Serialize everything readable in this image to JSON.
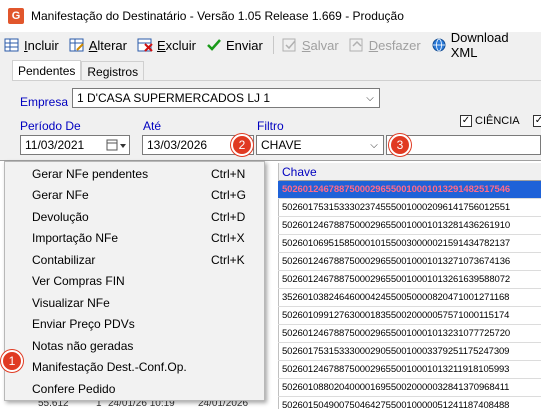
{
  "window": {
    "app_icon": "G",
    "title": "Manifestação do Destinatário - Versão 1.05 Release 1.669 - Produção"
  },
  "toolbar": [
    {
      "name": "incluir",
      "pre": "",
      "u": "I",
      "post": "ncluir",
      "icon": "grid-add-icon",
      "disabled": false
    },
    {
      "name": "alterar",
      "pre": "",
      "u": "A",
      "post": "lterar",
      "icon": "grid-edit-icon",
      "disabled": false
    },
    {
      "name": "excluir",
      "pre": "",
      "u": "E",
      "post": "xcluir",
      "icon": "grid-delete-icon",
      "disabled": false
    },
    {
      "name": "enviar",
      "pre": "",
      "u": "",
      "post": "Enviar",
      "icon": "checkmark-icon",
      "disabled": false
    },
    {
      "name": "salvar",
      "pre": "",
      "u": "S",
      "post": "alvar",
      "icon": "save-icon",
      "disabled": true
    },
    {
      "name": "desfazer",
      "pre": "",
      "u": "D",
      "post": "esfazer",
      "icon": "undo-icon",
      "disabled": true
    },
    {
      "name": "download-xml",
      "pre": "",
      "u": "",
      "post": "Download XML",
      "icon": "globe-icon",
      "disabled": false
    }
  ],
  "tabs": [
    "Pendentes",
    "Registros"
  ],
  "form": {
    "empresa_label": "Empresa",
    "empresa_value": "1 D'CASA SUPERMERCADOS LJ 1",
    "periodo_label": "Período De",
    "periodo_value": "11/03/2021",
    "ate_label": "Até",
    "ate_value": "13/03/2026",
    "filtro_label": "Filtro",
    "filtro_value": "CHAVE",
    "ciencia_label": "CIÊNCIA",
    "ciencia_checked": true,
    "second_checked": true
  },
  "badges": [
    "1",
    "2",
    "3"
  ],
  "grid": {
    "header": "Chave",
    "rows": [
      "50260124678875000296550010001013291482517546",
      "50260175315333023745550010002096141756012551",
      "50260124678875000296550010001013281436261910",
      "50260106951585000101550030000021591434782137",
      "50260124678875000296550010001013271073674136",
      "50260124678875000296550010001013261639588072",
      "35260103824646000424550050000820471001271168",
      "50260109912763000183550020000057571000115174",
      "50260124678875000296550010001013231077725720",
      "50260175315333000290550010003379251175247309",
      "50260124678875000296550010001013211918105993",
      "50260108802040000169550020000032841370968411",
      "50260150490075046427550010000051241187408488"
    ],
    "bottom_fragments": [
      "55.612",
      "1",
      "24/01/26 10:19",
      "24/01/2026"
    ]
  },
  "context_menu": [
    {
      "label": "Gerar NFe pendentes",
      "shortcut": "Ctrl+N"
    },
    {
      "label": "Gerar NFe",
      "shortcut": "Ctrl+G"
    },
    {
      "label": "Devolução",
      "shortcut": "Ctrl+D"
    },
    {
      "label": "Importação NFe",
      "shortcut": "Ctrl+X"
    },
    {
      "label": "Contabilizar",
      "shortcut": "Ctrl+K"
    },
    {
      "label": "Ver Compras FIN",
      "shortcut": ""
    },
    {
      "label": "Visualizar NFe",
      "shortcut": ""
    },
    {
      "label": "Enviar Preço PDVs",
      "shortcut": ""
    },
    {
      "label": "Notas não geradas",
      "shortcut": ""
    },
    {
      "label": "Manifestação Dest.-Conf.Op.",
      "shortcut": ""
    },
    {
      "label": "Confere Pedido",
      "shortcut": ""
    }
  ],
  "colors": {
    "badge": "#e03a22",
    "selection": "#1f62d8",
    "label_blue": "#0000c0"
  }
}
